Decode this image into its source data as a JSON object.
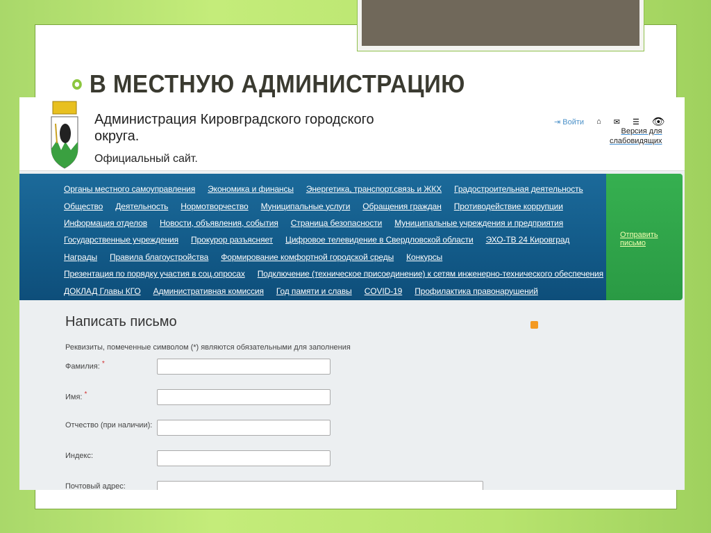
{
  "slide": {
    "title": "В МЕСТНУЮ АДМИНИСТРАЦИЮ"
  },
  "site": {
    "title": "Администрация Кировградского городского округа.",
    "subtitle": "Официальный сайт.",
    "login": "Войти",
    "low_vision": [
      "Версия для",
      "слабовидящих"
    ]
  },
  "nav": {
    "rows": [
      [
        "Органы местного самоуправления",
        "Экономика и финансы",
        "Энергетика, транспорт,связь и ЖКХ",
        "Градостроительная деятельность"
      ],
      [
        "Общество",
        "Деятельность",
        "Нормотворчество",
        "Муниципальные услуги",
        "Обращения граждан",
        "Противодействие коррупции"
      ],
      [
        "Информация отделов",
        "Новости, объявления, события",
        "Страница безопасности",
        "Муниципальные учреждения и предприятия"
      ],
      [
        "Государственные учреждения",
        "Прокурор разъясняет",
        "Цифровое телевидение в Свердловской области",
        "ЭХО-ТВ 24 Кировград"
      ],
      [
        "Награды",
        "Правила благоустройства",
        "Формирование комфортной городской среды",
        "Конкурсы"
      ],
      [
        "Презентация по порядку участия в соц.опросах",
        "Подключение (техническое присоединение) к сетям инженерно-технического обеспечения"
      ],
      [
        "ДОКЛАД Главы КГО",
        "Административная комиссия",
        "Год памяти и славы",
        "COVID-19",
        "Профилактика правонарушений"
      ]
    ],
    "send_letter": "Отправить письмо"
  },
  "form": {
    "title": "Написать письмо",
    "required_note": "Реквизиты, помеченные символом (*) являются обязательными для заполнения",
    "fields": [
      {
        "label": "Фамилия:",
        "required": "*"
      },
      {
        "label": "Имя:",
        "required": "*"
      },
      {
        "label": "Отчество (при наличии):"
      },
      {
        "label": "Индекс:"
      },
      {
        "label": "Почтовый адрес:"
      }
    ]
  }
}
